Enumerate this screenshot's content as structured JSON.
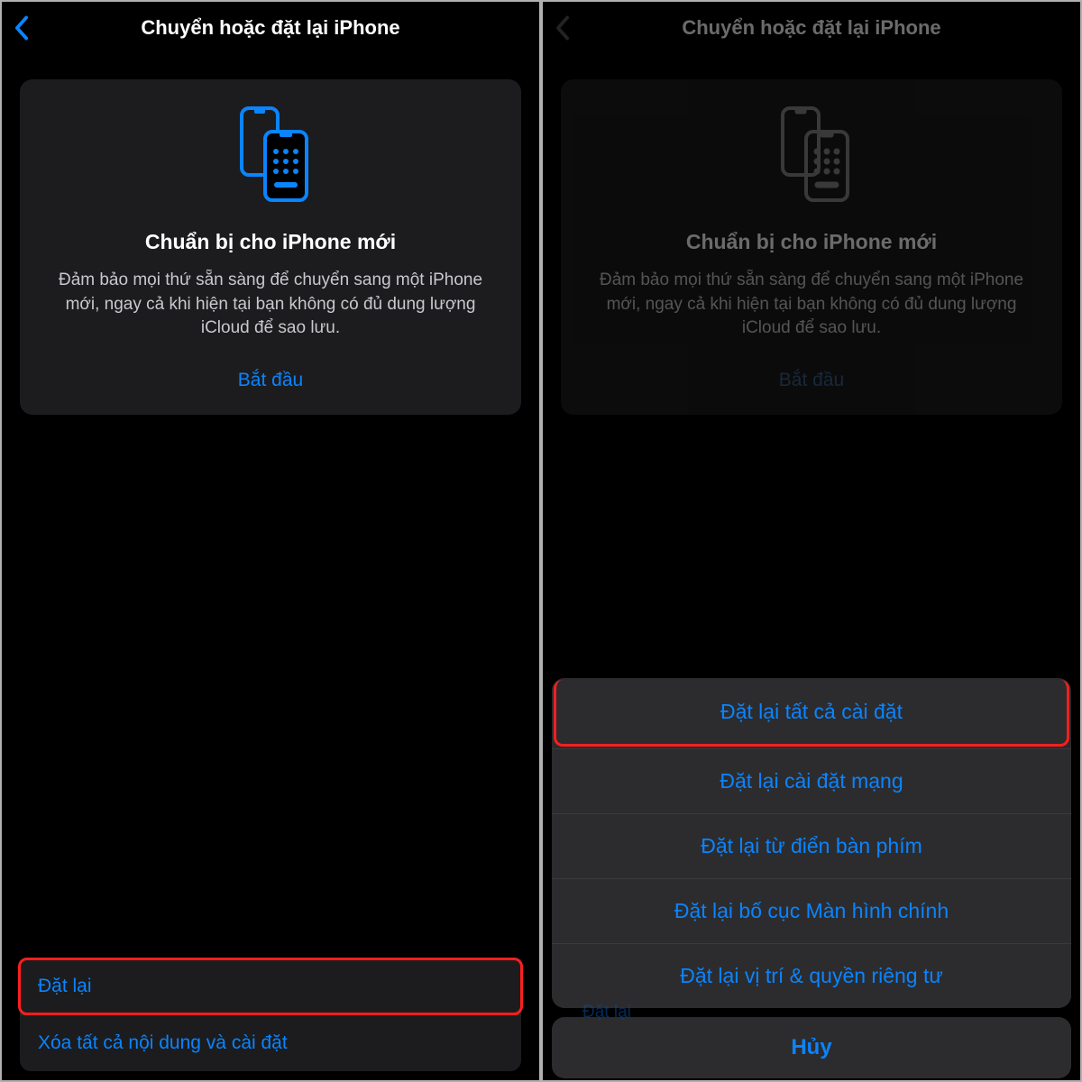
{
  "left": {
    "header_title": "Chuyển hoặc đặt lại iPhone",
    "card": {
      "title": "Chuẩn bị cho iPhone mới",
      "description": "Đảm bảo mọi thứ sẵn sàng để chuyển sang một iPhone mới, ngay cả khi hiện tại bạn không có đủ dung lượng iCloud để sao lưu.",
      "cta": "Bắt đầu"
    },
    "options": {
      "reset": "Đặt lại",
      "erase": "Xóa tất cả nội dung và cài đặt"
    }
  },
  "right": {
    "header_title": "Chuyển hoặc đặt lại iPhone",
    "card": {
      "title": "Chuẩn bị cho iPhone mới",
      "description": "Đảm bảo mọi thứ sẵn sàng để chuyển sang một iPhone mới, ngay cả khi hiện tại bạn không có đủ dung lượng iCloud để sao lưu.",
      "cta": "Bắt đầu"
    },
    "peek_label": "Đặt lại",
    "sheet": {
      "options": [
        "Đặt lại tất cả cài đặt",
        "Đặt lại cài đặt mạng",
        "Đặt lại từ điển bàn phím",
        "Đặt lại bố cục Màn hình chính",
        "Đặt lại vị trí & quyền riêng tư"
      ],
      "cancel": "Hủy"
    }
  },
  "colors": {
    "accent": "#0a84ff",
    "highlight": "#ff1e1e"
  }
}
